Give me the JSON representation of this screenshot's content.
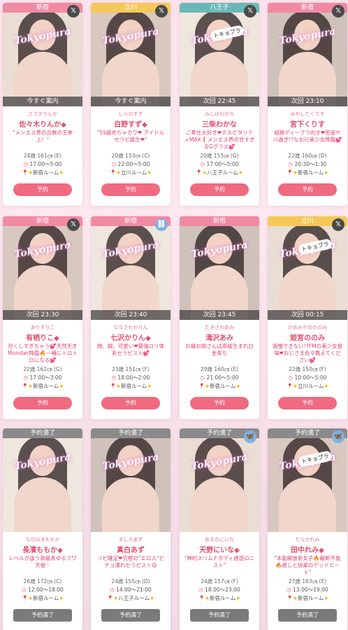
{
  "colors": {
    "accent": "#f06a80",
    "full": "#7a7a7a",
    "name": "#e0506e"
  },
  "reserve_label": "予約",
  "full_label": "予約満了",
  "watermark": "Tokyopura",
  "sticker": "トキョプラ",
  "cards": [
    {
      "area": "新宿",
      "area_color": "pink",
      "badge": "x-icon",
      "next": "今すぐ案内",
      "kana": "ささきりんか",
      "name": "佐々木りんか◆",
      "catch": "\"メンエス界の百獣の王参上！\"",
      "stats": "24歳 161㎝ (E)",
      "hours": "17:00〜5:00",
      "room": "新宿ルーム",
      "status": "open"
    },
    {
      "area": "立川",
      "area_color": "gold",
      "badge": "x-icon",
      "next": "今すぐ案内",
      "kana": "しらのすず",
      "name": "白野すず◆",
      "catch": "\"SS級めちゃカワ❤ アイドルセラピ誕生❤\"",
      "stats": "20歳 153㎝ (C)",
      "hours": "22:00〜5:00",
      "room": "立川ルーム",
      "status": "open"
    },
    {
      "area": "八王子",
      "area_color": "teal",
      "badge": "x-icon",
      "next": "次回 22:45",
      "kana": "みしばわかな",
      "name": "三柴わかな",
      "catch": "ご奉仕大好き❤ホスピタリティMAX❗メンエス界の甘すぎるGグラス💕",
      "stats": "20歳 155㎝ (G)",
      "hours": "17:00〜5:00",
      "room": "八王子ルーム",
      "status": "open"
    },
    {
      "area": "新宿",
      "area_color": "pink",
      "badge": "x-icon",
      "next": "次回 23:10",
      "kana": "みやしたくりす",
      "name": "宮下くりす",
      "catch": "超絶ディープラ向き❤密度ヤバ過ぎ!?なお行美少女降臨💕",
      "stats": "22歳 160㎝ (D)",
      "hours": "20:30〜1:30",
      "room": "新宿ルーム",
      "status": "open"
    },
    {
      "area": "新宿",
      "area_color": "pink",
      "badge": "x-icon",
      "next": "次回 23:30",
      "kana": "ありすりこ",
      "name": "有栖りこ◆",
      "catch": "尽くしすぎちゃう💕天然天才Monster降臨🔥一補にトロトロになる💕",
      "stats": "22歳 162㎝ (G)",
      "hours": "17:00〜3:00",
      "room": "新宿ルーム",
      "status": "open"
    },
    {
      "area": "新宿",
      "area_color": "pink",
      "badge": "link-icon",
      "next": "次回 23:40",
      "kana": "ななさわかりん",
      "name": "七沢かりん◆",
      "catch": "顔、脚、可愛い❤最強ロリ体系セラピスト💕",
      "stats": "23歳 151㎝ (F)",
      "hours": "18:00〜2:00",
      "room": "新宿ルーム",
      "status": "open"
    },
    {
      "area": "新宿",
      "area_color": "pink",
      "badge": "",
      "next": "次回 23:45",
      "kana": "たきざわあみ",
      "name": "滝沢あみ",
      "catch": "お嬢お姉さんは高級生まれ白金育ち",
      "stats": "29歳 160㎝ (E)",
      "hours": "21:00〜5:00",
      "room": "新宿ルーム",
      "status": "open"
    },
    {
      "area": "立川",
      "area_color": "gold",
      "badge": "x-icon",
      "next": "次回 00:15",
      "kana": "ひめみやのののみ",
      "name": "姫宮ののみ",
      "catch": "我慢できない!?FMの美少女登場❤おじさま色々教えてください💕",
      "stats": "22歳 150㎝ (F)",
      "hours": "10:00〜5:00",
      "room": "立川ルーム",
      "status": "open"
    },
    {
      "area": "予約満了",
      "area_color": "gray",
      "badge": "",
      "next": "",
      "kana": "ながはまももか",
      "name": "長濱ももか◆",
      "catch": "レベルが違う高級系ゆるフワ天使♡",
      "stats": "26歳 172㎝ (C)",
      "hours": "12:00〜18:00",
      "room": "新宿ルーム",
      "status": "full"
    },
    {
      "area": "予約満了",
      "area_color": "gray",
      "badge": "",
      "next": "",
      "kana": "ましろあず",
      "name": "真白あず",
      "catch": "リピ確定❤究極の\"エロス\"ビチョ濡れセラピスト😋",
      "stats": "24歳 155㎝ (D)",
      "hours": "14:00〜21:00",
      "room": "八王子ルーム",
      "status": "full"
    },
    {
      "area": "予約満了",
      "area_color": "gray",
      "badge": "butterfly-icon",
      "next": "",
      "kana": "あまのにいな",
      "name": "天野にいな◆",
      "catch": "\"神的スリムＦボディ誘惑ロニスト\"",
      "stats": "24歳 157㎝ (F)",
      "hours": "18:00〜23:00",
      "room": "新宿ルーム",
      "status": "full"
    },
    {
      "area": "予約満了",
      "area_color": "gray",
      "badge": "butterfly-icon",
      "next": "",
      "kana": "たなかれみ",
      "name": "田中れみ◆",
      "catch": "\"本能解放系女子🔥敵断不能🔥癒しと快楽のデッドヒート\"",
      "stats": "27歳 163㎝ (E)",
      "hours": "13:00〜19:00",
      "room": "新宿ルーム",
      "status": "full"
    }
  ]
}
